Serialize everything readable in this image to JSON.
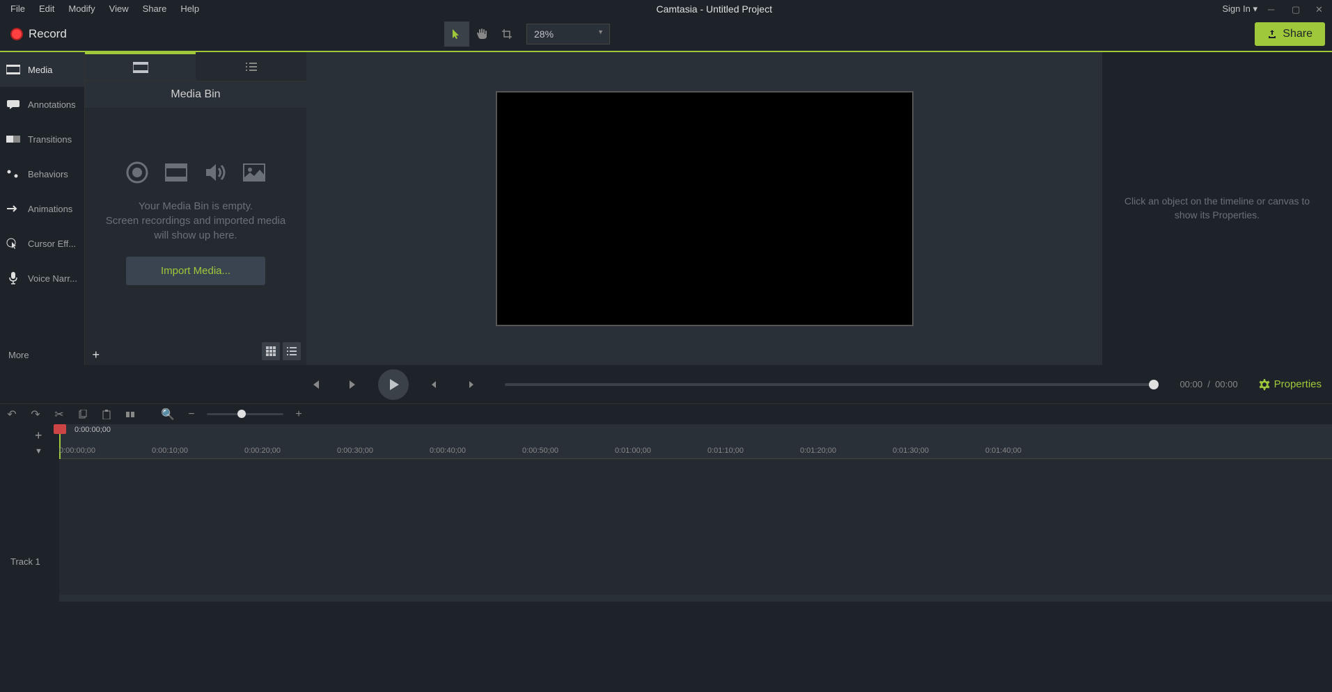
{
  "app": {
    "title": "Camtasia - Untitled Project",
    "signin": "Sign In ▾"
  },
  "menu": {
    "items": [
      "File",
      "Edit",
      "Modify",
      "View",
      "Share",
      "Help"
    ]
  },
  "toolbar": {
    "record": "Record",
    "share": "Share",
    "zoom": "28%"
  },
  "sidebar": {
    "items": [
      {
        "label": "Media"
      },
      {
        "label": "Annotations"
      },
      {
        "label": "Transitions"
      },
      {
        "label": "Behaviors"
      },
      {
        "label": "Animations"
      },
      {
        "label": "Cursor Eff..."
      },
      {
        "label": "Voice Narr..."
      }
    ],
    "more": "More"
  },
  "media_bin": {
    "title": "Media Bin",
    "empty1": "Your Media Bin is empty.",
    "empty2": "Screen recordings and imported media will show up here.",
    "import": "Import Media..."
  },
  "properties": {
    "placeholder": "Click an object on the timeline or canvas to show its Properties.",
    "button": "Properties"
  },
  "playback": {
    "current": "00:00",
    "sep": "/",
    "total": "00:00"
  },
  "timeline": {
    "playhead_time": "0:00:00;00",
    "marks": [
      "0:00:00;00",
      "0:00:10;00",
      "0:00:20;00",
      "0:00:30;00",
      "0:00:40;00",
      "0:00:50;00",
      "0:01:00;00",
      "0:01:10;00",
      "0:01:20;00",
      "0:01:30;00",
      "0:01:40;00"
    ],
    "track1": "Track 1"
  }
}
